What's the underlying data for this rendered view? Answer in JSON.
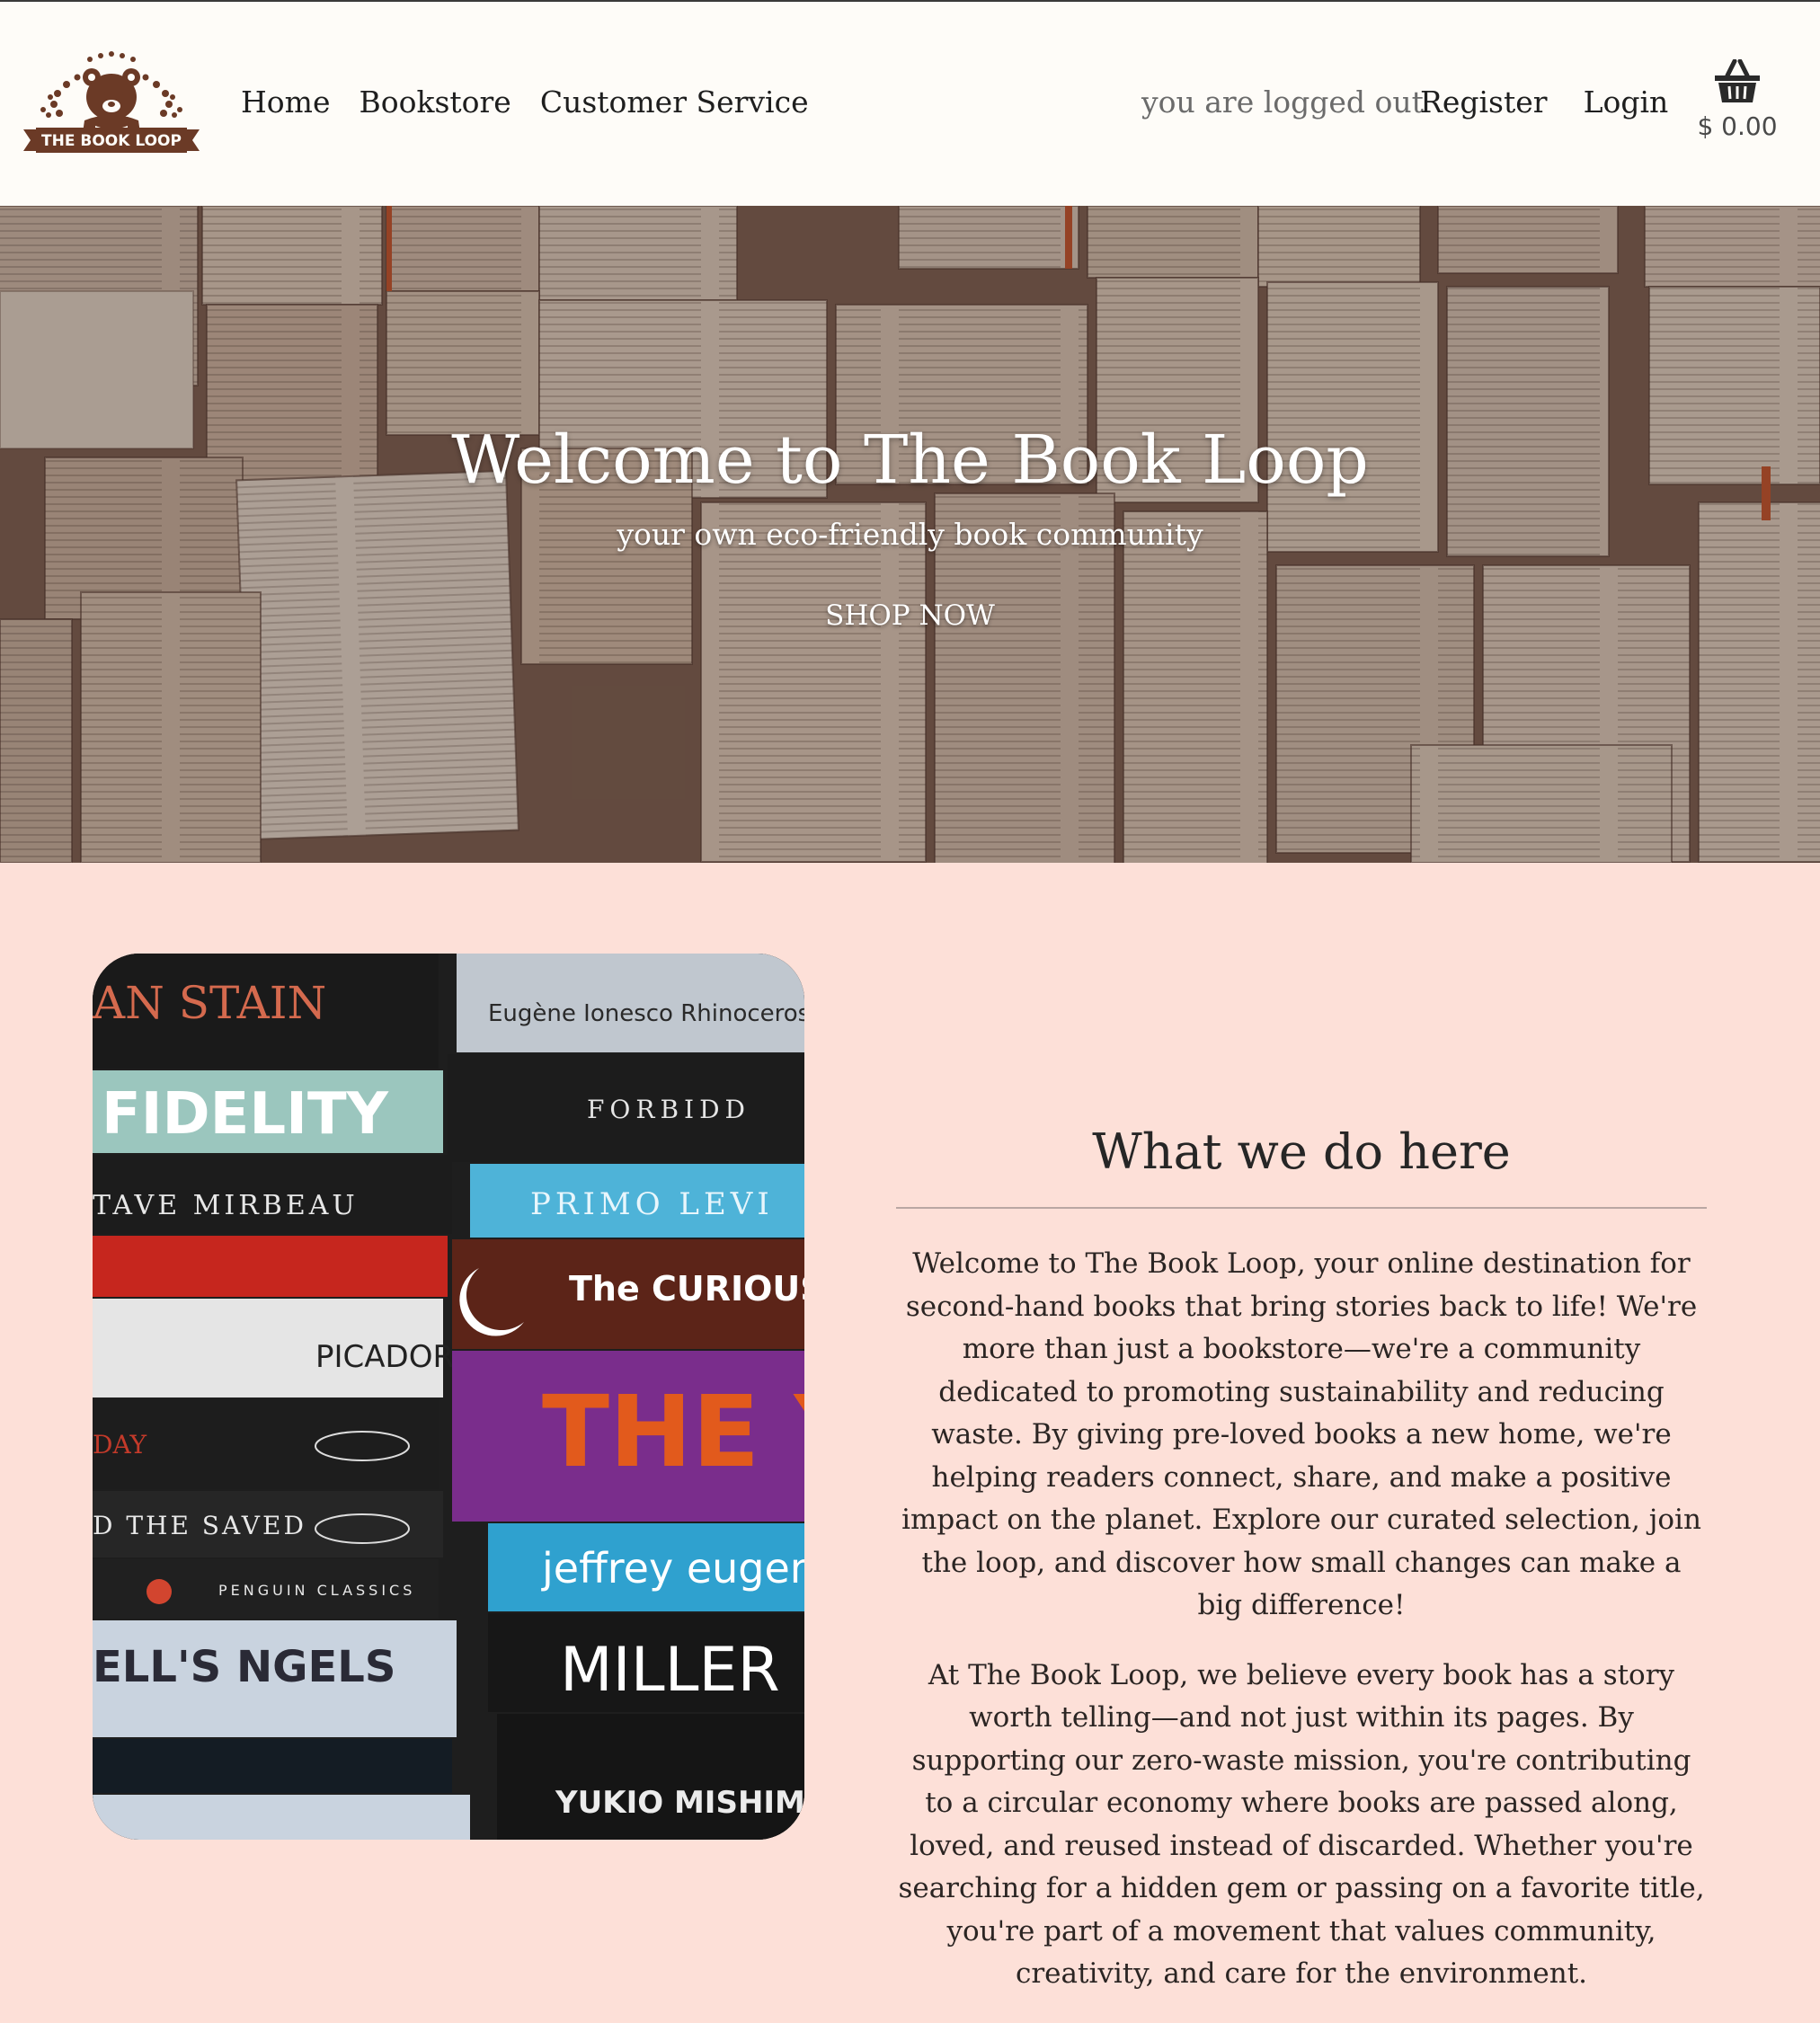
{
  "brand": {
    "logo_text": "THE BOOK LOOP"
  },
  "nav": {
    "items": [
      "Home",
      "Bookstore",
      "Customer Service"
    ]
  },
  "account": {
    "status": "you are logged out",
    "register": "Register",
    "login": "Login"
  },
  "cart": {
    "icon": "basket-icon",
    "total": "$ 0.00"
  },
  "hero": {
    "title": "Welcome to The Book Loop",
    "subtitle": "your own eco-friendly book community",
    "button": "SHOP NOW"
  },
  "about": {
    "title": "What we do here",
    "paragraphs": [
      "Welcome to The Book Loop, your online destination for second-hand books that bring stories back to life! We're more than just a bookstore—we're a community dedicated to promoting sustainability and reducing waste. By giving pre-loved books a new home, we're helping readers connect, share, and make a positive impact on the planet. Explore our curated selection, join the loop, and discover how small changes can make a big difference!",
      "At The Book Loop, we believe every book has a story worth telling—and not just within its pages. By supporting our zero-waste mission, you're contributing to a circular economy where books are passed along, loved, and reused instead of discarded. Whether you're searching for a hidden gem or passing on a favorite title, you're part of a movement that values community, creativity, and care for the environment."
    ]
  },
  "book_spines": [
    "AN STAIN",
    "FIDELITY",
    "TAVE MIRBEAU",
    "",
    "PICADOR",
    "DAY",
    "D THE SAVED",
    "PENGUIN CLASSICS",
    "ELL'S NGELS",
    "Eugène Ionesco Rhinoceros",
    "FORBIDD",
    "PRIMO LEVI",
    "The CURIOUS of THE DOG IN",
    "THE YEAR OF THE FLOO",
    "jeffrey eugenid",
    "MILLER",
    "YUKIO MISHIM"
  ],
  "colors": {
    "page_bg": "#fde0d8",
    "header_bg": "#fefcf8",
    "brand_brown": "#6b3a26"
  }
}
